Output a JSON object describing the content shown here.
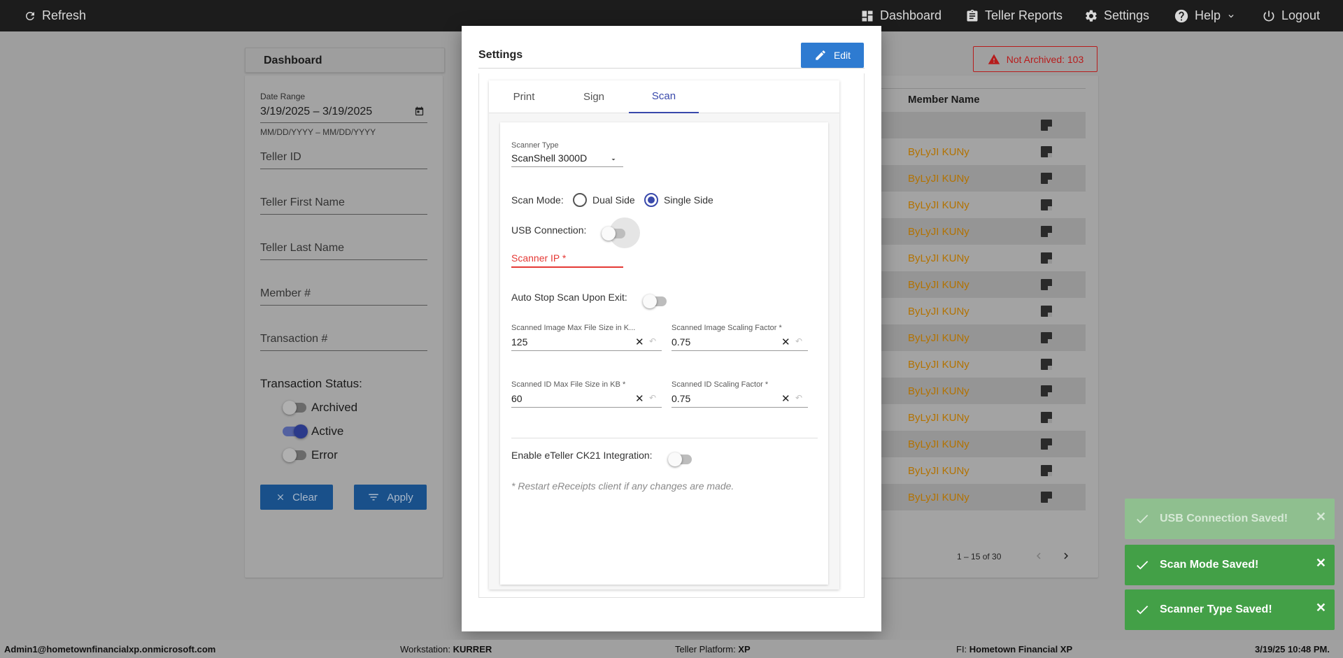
{
  "topbar": {
    "refresh": "Refresh",
    "dashboard": "Dashboard",
    "teller_reports": "Teller Reports",
    "settings": "Settings",
    "help": "Help",
    "logout": "Logout"
  },
  "dashboard": {
    "title": "Dashboard",
    "date_range_label": "Date Range",
    "date_range_value": "3/19/2025 – 3/19/2025",
    "date_hint": "MM/DD/YYYY – MM/DD/YYYY",
    "teller_id": "Teller ID",
    "teller_first_name": "Teller First Name",
    "teller_last_name": "Teller Last Name",
    "member_no": "Member #",
    "transaction_no": "Transaction #",
    "transaction_status_label": "Transaction Status:",
    "status_archived": "Archived",
    "status_active": "Active",
    "status_error": "Error",
    "status_archived_on": false,
    "status_active_on": true,
    "status_error_on": false,
    "clear_button": "Clear",
    "apply_button": "Apply"
  },
  "table": {
    "not_archived": "Not Archived: 103",
    "member_name_header": "Member Name",
    "rows": [
      "",
      "ByLyJI KUNy",
      "ByLyJI KUNy",
      "ByLyJI KUNy",
      "ByLyJI KUNy",
      "ByLyJI KUNy",
      "ByLyJI KUNy",
      "ByLyJI KUNy",
      "ByLyJI KUNy",
      "ByLyJI KUNy",
      "ByLyJI KUNy",
      "ByLyJI KUNy",
      "ByLyJI KUNy",
      "ByLyJI KUNy",
      "ByLyJI KUNy"
    ],
    "pager": "1 – 15 of 30"
  },
  "modal": {
    "title": "Settings",
    "edit_button": "Edit",
    "tabs": [
      "Print",
      "Sign",
      "Scan"
    ],
    "active_tab": "Scan",
    "scanner_type_label": "Scanner Type",
    "scanner_type_value": "ScanShell 3000D",
    "scan_mode_label": "Scan Mode:",
    "scan_mode_options": [
      "Dual Side",
      "Single Side"
    ],
    "scan_mode_selected": "Single Side",
    "usb_connection_label": "USB Connection:",
    "usb_connection_on": false,
    "scanner_ip_label": "Scanner IP *",
    "auto_stop_label": "Auto Stop Scan Upon Exit:",
    "auto_stop_on": false,
    "img_max_size_label": "Scanned Image Max File Size in K...",
    "img_max_size_value": "125",
    "img_scaling_label": "Scanned Image Scaling Factor *",
    "img_scaling_value": "0.75",
    "id_max_size_label": "Scanned ID Max File Size in KB *",
    "id_max_size_value": "60",
    "id_scaling_label": "Scanned ID Scaling Factor *",
    "id_scaling_value": "0.75",
    "eteller_label": "Enable eTeller CK21 Integration:",
    "eteller_on": false,
    "restart_note": "* Restart eReceipts client if any changes are made."
  },
  "toasts": [
    {
      "message": "USB Connection Saved!",
      "faded": true
    },
    {
      "message": "Scan Mode Saved!",
      "faded": false
    },
    {
      "message": "Scanner Type Saved!",
      "faded": false
    }
  ],
  "statusbar": {
    "user": "Admin1@hometownfinancialxp.onmicrosoft.com",
    "workstation_label": "Workstation:",
    "workstation_value": "KURRER",
    "platform_label": "Teller Platform:",
    "platform_value": "XP",
    "fi_label": "FI:",
    "fi_value": "Hometown Financial XP",
    "datetime": "3/19/25 10:48 PM."
  },
  "colors": {
    "primary": "#3949ab",
    "edit_button": "#2e7bd1",
    "toast_green": "#43a047",
    "error_red": "#e53935",
    "member_link": "#b37200"
  }
}
